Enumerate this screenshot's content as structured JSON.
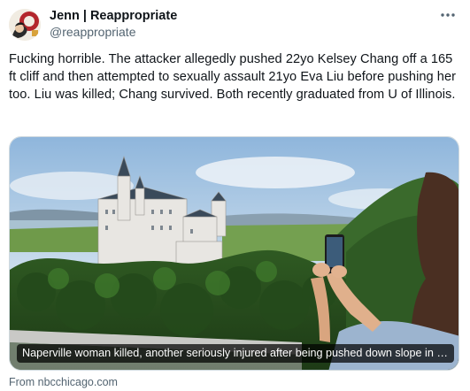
{
  "author": {
    "display_name": "Jenn | Reappropriate",
    "handle": "@reappropriate"
  },
  "menu": {
    "more_icon": "more-horizontal-icon"
  },
  "tweet": {
    "text": "Fucking horrible. The attacker allegedly pushed 22yo Kelsey Chang off a 165 ft cliff and then attempted to sexually assault 21yo Eva Liu before pushing her too. Liu was killed; Chang survived. Both recently graduated from U of Illinois."
  },
  "link_card": {
    "caption": "Naperville woman killed, another seriously injured after being pushed down slope in Ger...",
    "source": "From nbcchicago.com"
  },
  "colors": {
    "text": "#0f1419",
    "secondary": "#536471",
    "border": "#cfd9de"
  }
}
